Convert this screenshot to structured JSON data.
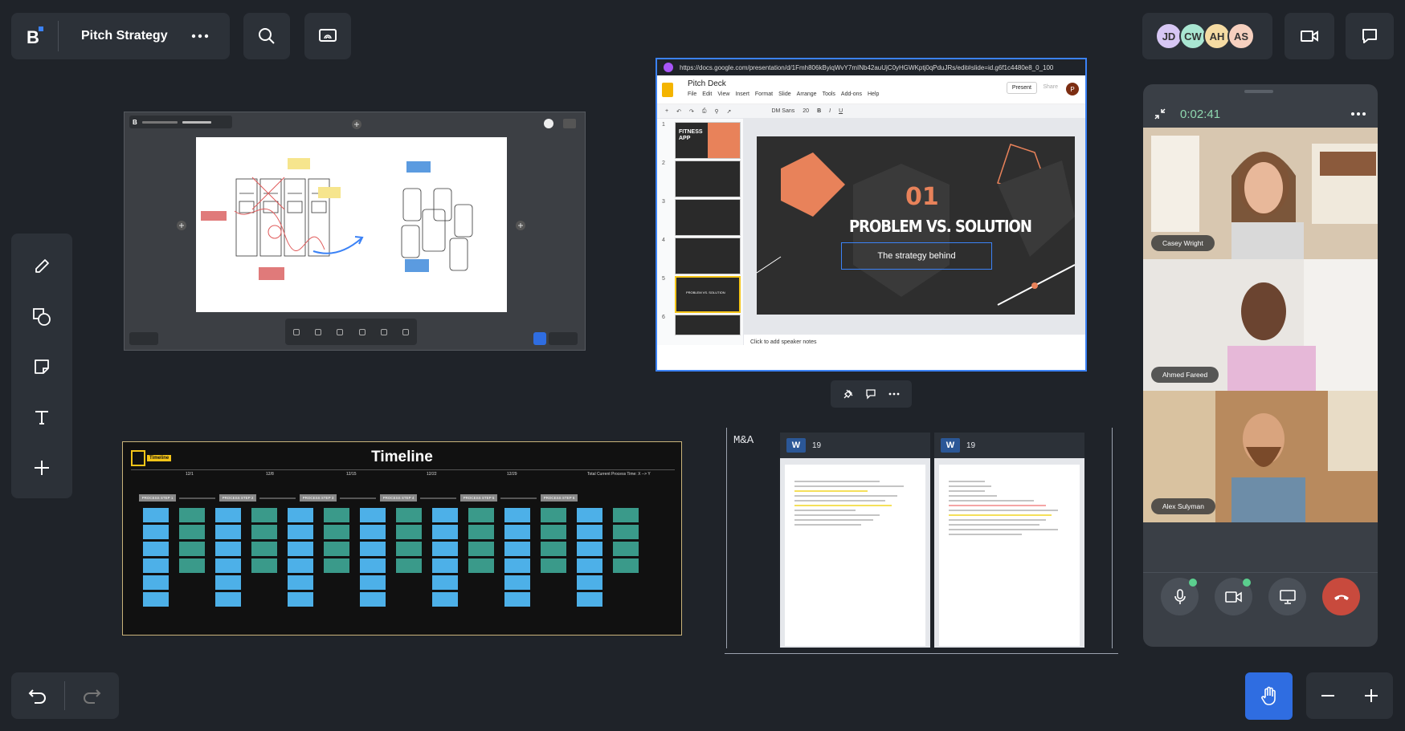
{
  "board": {
    "title": "Pitch Strategy"
  },
  "participants": [
    {
      "initials": "JD",
      "color": "#d7c7f4"
    },
    {
      "initials": "CW",
      "color": "#a9e6d2"
    },
    {
      "initials": "AH",
      "color": "#f5dba3"
    },
    {
      "initials": "AS",
      "color": "#f6d0bf"
    }
  ],
  "slides": {
    "url": "https://docs.google.com/presentation/d/1Fmh806kByiqWvY7mINb42auUjC0yHGWKptj0qPduJRs/edit#slide=id.g6f1c4480e8_0_100",
    "doc_title": "Pitch Deck",
    "menu": [
      "File",
      "Edit",
      "View",
      "Insert",
      "Format",
      "Slide",
      "Arrange",
      "Tools",
      "Add-ons",
      "Help"
    ],
    "present_label": "Present",
    "share_label": "Share",
    "user_initial": "P",
    "font_name": "DM Sans",
    "font_size": "20",
    "thumbnails": [
      {
        "num": "1",
        "label": "FITNESS APP"
      },
      {
        "num": "2",
        "label": ""
      },
      {
        "num": "3",
        "label": ""
      },
      {
        "num": "4",
        "label": ""
      },
      {
        "num": "5",
        "label": "PROBLEM VS. SOLUTION"
      },
      {
        "num": "6",
        "label": ""
      }
    ],
    "slide_number": "01",
    "slide_title": "PROBLEM VS. SOLUTION",
    "slide_text": "The strategy behind",
    "speaker_notes": "Click to add speaker notes"
  },
  "timeline": {
    "badge": "Timeline",
    "title": "Timeline",
    "milestones": [
      "12/1",
      "12/8",
      "12/15",
      "12/22",
      "12/29",
      "Total Current Process Time: X --> Y"
    ],
    "steps": [
      "PROCESS STEP 1",
      "PROCESS STEP 2",
      "PROCESS STEP 3",
      "PROCESS STEP 4",
      "PROCESS STEP 5",
      "PROCESS STEP 6"
    ]
  },
  "ma": {
    "label": "M&A",
    "docs": [
      {
        "count": "19"
      },
      {
        "count": "19"
      }
    ]
  },
  "call": {
    "timer": "0:02:41",
    "participants": [
      {
        "name": "Casey Wright"
      },
      {
        "name": "Ahmed Fareed"
      },
      {
        "name": "Alex Sulyman"
      }
    ]
  },
  "colors": {
    "accent": "#2f6de1",
    "slides_selection": "#3b82f6",
    "end_call": "#c84a3d",
    "timer": "#8fd8b0"
  }
}
